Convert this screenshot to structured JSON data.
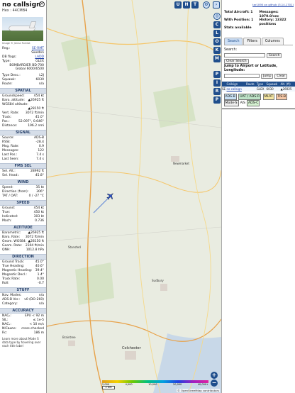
{
  "aircraft": {
    "callsign": "no callsign",
    "hex_label": "Hex :",
    "hex": "44CMB4",
    "photo_credit": "Image © Jenna Forrest",
    "close_symbol": "×",
    "reg_label": "Reg.:",
    "reg": "SE-RMT",
    "country": "Sweden",
    "db_flags_label": "DB flags:",
    "db_flags": "LADD",
    "type_label": "Type:",
    "type": "GLEX",
    "desc_line1": "BOMBARDIER BD-700",
    "desc_line2": "Global 6000/6500",
    "type_desc_label": "Type Desc.:",
    "type_desc": "L2J",
    "squawk_label": "Squawk:",
    "squawk": "6030",
    "route_label": "Route:",
    "route": "n/a"
  },
  "sections": {
    "spatial": "SPATIAL",
    "signal": "SIGNAL",
    "fms_sel": "FMS SEL",
    "wind": "WIND",
    "speed": "SPEED",
    "altitude": "ALTITUDE",
    "direction": "DIRECTION",
    "stuff": "STUFF",
    "accuracy": "ACCURACY"
  },
  "spatial": [
    {
      "k": "Groundspeed:",
      "v": "454 kt"
    },
    {
      "k": "Baro. altitude:",
      "v": "▲26925 ft"
    },
    {
      "k": "WGS84 altitude:",
      "v": ""
    },
    {
      "k": "",
      "v": "▲28150 ft"
    },
    {
      "k": "Vert. Rate:",
      "v": "3072 ft/min"
    },
    {
      "k": "Track:",
      "v": "45.0°"
    },
    {
      "k": "Pos.:",
      "v": "52.097°, 0.646°"
    },
    {
      "k": "Distance:",
      "v": "196.2 nmi"
    }
  ],
  "signal": [
    {
      "k": "Source:",
      "v": "ADS-B"
    },
    {
      "k": "RSSI:",
      "v": "-28.4"
    },
    {
      "k": "Msg. Rate:",
      "v": "0.9"
    },
    {
      "k": "Messages:",
      "v": "122"
    },
    {
      "k": "Last Pos.:",
      "v": "7.4 s"
    },
    {
      "k": "Last Seen:",
      "v": "7.4 s"
    }
  ],
  "fms": [
    {
      "k": "Sel. Alt.:",
      "v": "28992 ft"
    },
    {
      "k": "Sel. Head.:",
      "v": "45.8°"
    }
  ],
  "wind": [
    {
      "k": "Speed:",
      "v": "35 kt"
    },
    {
      "k": "Direction (from):",
      "v": "306°"
    },
    {
      "k": "TAT / OAT:",
      "v": "0 / -27 °C"
    }
  ],
  "speed": [
    {
      "k": "Ground:",
      "v": "454 kt"
    },
    {
      "k": "True:",
      "v": "450 kt"
    },
    {
      "k": "Indicated:",
      "v": "303 kt"
    },
    {
      "k": "Mach:",
      "v": "0.736"
    }
  ],
  "altitude": [
    {
      "k": "Barometric:",
      "v": "▲26925 ft"
    },
    {
      "k": "Baro. Rate:",
      "v": "3072 ft/min"
    },
    {
      "k": "Geom. WGS84:",
      "v": "▲28150 ft"
    },
    {
      "k": "Geom. Rate:",
      "v": "2304 ft/min"
    },
    {
      "k": "QNH:",
      "v": "1012.8 hPa"
    }
  ],
  "direction": [
    {
      "k": "Ground Track:",
      "v": "45.0°"
    },
    {
      "k": "True Heading:",
      "v": "40.6°"
    },
    {
      "k": "Magnetic Heading:",
      "v": "39.4°"
    },
    {
      "k": "Magnetic Decl.:",
      "v": "1.4°"
    },
    {
      "k": "Track Rate:",
      "v": "0.00"
    },
    {
      "k": "Roll:",
      "v": "-0.7"
    }
  ],
  "stuff": [
    {
      "k": "Nav. Modes:",
      "v": "n/a"
    },
    {
      "k": "ADS-B Ver.:",
      "v": "v0 (DO-260)"
    },
    {
      "k": "Category:",
      "v": "n/a"
    }
  ],
  "accuracy": [
    {
      "k": "NACₚ:",
      "v": "EPU < 92 m"
    },
    {
      "k": "SIL:",
      "v": "≤ 1e-5"
    },
    {
      "k": "NACᵥ:",
      "v": "< 10 m/s"
    },
    {
      "k": "NICʙᴀʀᴏ:",
      "v": "cross-checked"
    },
    {
      "k": "Rc:",
      "v": "186 m"
    }
  ],
  "learn_more": "Learn more about Mode S data type by hovering over each title label",
  "map": {
    "buttons_top": [
      "U",
      "H",
      "T"
    ],
    "side_buttons": [
      "C",
      "L",
      "O",
      "K",
      "M",
      "P",
      "I",
      "R",
      "P"
    ],
    "zoom_in": "+",
    "zoom_out": "−",
    "scale_ticks": [
      "2,000",
      "4,000",
      "10,000",
      "20,000",
      "40,000+"
    ],
    "scale_box": "2 NM",
    "attribution": "© OpenStreetMap contributors",
    "aircraft_color": "#2850c8",
    "trail_color": "#6a8fd8",
    "place_labels": [
      "Newmarket",
      "Sudbury",
      "Colchester",
      "Stansted",
      "Braintree"
    ]
  },
  "right": {
    "top_link": "tar1090 on github (3.14.1701)",
    "total_aircraft_label": "Total Aircraft: 1",
    "messages_label": "Messages:",
    "messages_value": "1070.0/sec",
    "with_position_label": "With Position: 1",
    "history_label": "History: 13322",
    "history_value": "positions",
    "stats_label": "Stats available",
    "tabs": [
      "Search",
      "Filters",
      "Columns"
    ],
    "search_label": "Search:",
    "search_button": "Search",
    "clear_search_button": "Clear Search",
    "jump_label": "Jump to Airport or Latitude, Longitude:",
    "jump_button": "Jump",
    "clear_button": "Clear",
    "table_headers": [
      "",
      "Callsign",
      "Route",
      "Type",
      "Squawk",
      "Alt. (ft)"
    ],
    "table_rows": [
      {
        "flag": "SE",
        "callsign": "no callsign",
        "route": "",
        "type": "GLEX",
        "squawk": "6030",
        "alt": "▲26925"
      }
    ],
    "legend": [
      "ADS-B",
      "UAT / ADS-R",
      "MLAT",
      "TIS-B",
      "Mode-S",
      "AIS",
      "ADS-C"
    ]
  }
}
